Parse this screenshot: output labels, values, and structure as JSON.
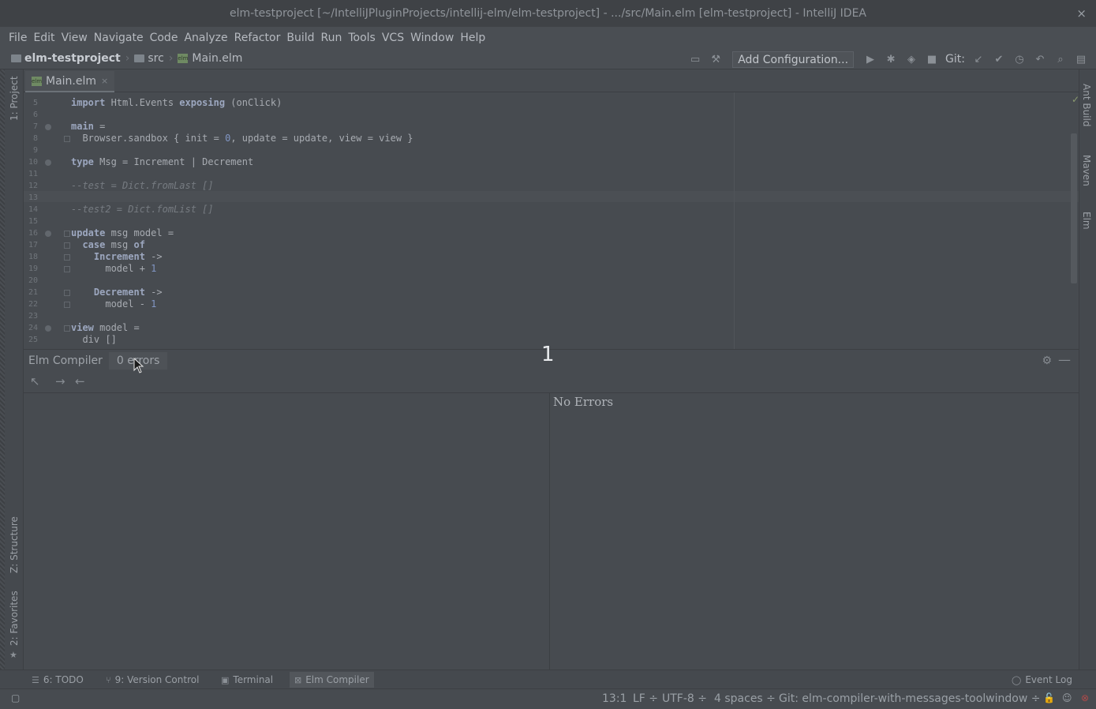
{
  "window": {
    "title": "elm-testproject [~/IntelliJPluginProjects/intellij-elm/elm-testproject] - .../src/Main.elm [elm-testproject] - IntelliJ IDEA",
    "close": "×"
  },
  "menu": [
    "File",
    "Edit",
    "View",
    "Navigate",
    "Code",
    "Analyze",
    "Refactor",
    "Build",
    "Run",
    "Tools",
    "VCS",
    "Window",
    "Help"
  ],
  "breadcrumb": {
    "project": "elm-testproject",
    "folder": "src",
    "file": "Main.elm"
  },
  "toolbar": {
    "add_configuration": "Add Configuration...",
    "git_label": "Git:"
  },
  "left_strip": {
    "project": "1: Project",
    "structure": "Z: Structure",
    "favorites": "2: Favorites"
  },
  "right_strip": {
    "ant": "Ant Build",
    "maven": "Maven",
    "elm": "Elm"
  },
  "editor": {
    "tab_label": "Main.elm",
    "tab_close": "×",
    "lines": [
      {
        "n": "5",
        "html": "<span class=\"kw\">import</span> Html.Events <span class=\"kw\">exposing</span> (onClick)"
      },
      {
        "n": "6",
        "html": ""
      },
      {
        "n": "7",
        "html": "<span class=\"kw\">main</span> ="
      },
      {
        "n": "8",
        "html": "  Browser.sandbox { init = <span class=\"num\">0</span>, update = update, view = view }"
      },
      {
        "n": "9",
        "html": ""
      },
      {
        "n": "10",
        "html": "<span class=\"kw\">type</span> Msg = Increment | Decrement"
      },
      {
        "n": "11",
        "html": ""
      },
      {
        "n": "12",
        "html": "<span class=\"cm\">--test = Dict.fromLast []</span>"
      },
      {
        "n": "13",
        "html": ""
      },
      {
        "n": "14",
        "html": "<span class=\"cm\">--test2 = Dict.fomList []</span>"
      },
      {
        "n": "15",
        "html": ""
      },
      {
        "n": "16",
        "html": "<span class=\"kw\">update</span> msg model ="
      },
      {
        "n": "17",
        "html": "  <span class=\"kw\">case</span> msg <span class=\"kw\">of</span>"
      },
      {
        "n": "18",
        "html": "    <span class=\"kw\">Increment</span> ->"
      },
      {
        "n": "19",
        "html": "      model + <span class=\"num\">1</span>"
      },
      {
        "n": "20",
        "html": ""
      },
      {
        "n": "21",
        "html": "    <span class=\"kw\">Decrement</span> ->"
      },
      {
        "n": "22",
        "html": "      model - <span class=\"num\">1</span>"
      },
      {
        "n": "23",
        "html": ""
      },
      {
        "n": "24",
        "html": "<span class=\"kw\">view</span> model ="
      },
      {
        "n": "25",
        "html": "  div []"
      }
    ]
  },
  "tool_window": {
    "title": "Elm Compiler",
    "tab": "0 errors",
    "message": "No Errors",
    "overlay_number": "1"
  },
  "bottom_tabs": {
    "todo": "6: TODO",
    "vcs": "9: Version Control",
    "terminal": "Terminal",
    "elm": "Elm Compiler",
    "event_log": "Event Log"
  },
  "status": {
    "position": "13:1",
    "line_sep": "LF ÷",
    "encoding": "UTF-8 ÷",
    "indent": "4 spaces ÷",
    "branch": "Git: elm-compiler-with-messages-toolwindow ÷"
  }
}
